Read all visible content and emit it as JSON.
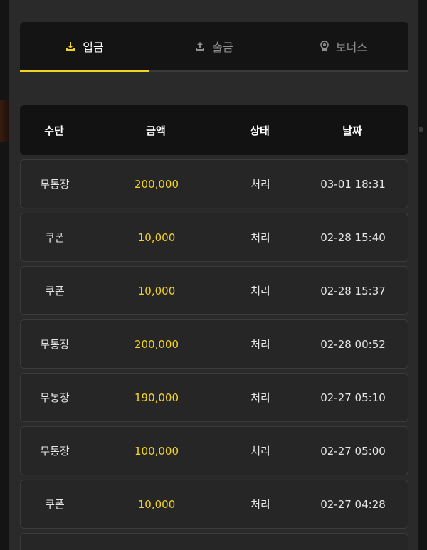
{
  "tabs": [
    {
      "label": "입금",
      "icon": "download-icon",
      "active": true
    },
    {
      "label": "출금",
      "icon": "upload-icon",
      "active": false
    },
    {
      "label": "보너스",
      "icon": "medal-icon",
      "active": false
    }
  ],
  "table": {
    "headers": [
      "수단",
      "금액",
      "상태",
      "날짜"
    ],
    "rows": [
      {
        "method": "무통장",
        "amount": "200,000",
        "status": "처리",
        "date": "03-01 18:31"
      },
      {
        "method": "쿠폰",
        "amount": "10,000",
        "status": "처리",
        "date": "02-28 15:40"
      },
      {
        "method": "쿠폰",
        "amount": "10,000",
        "status": "처리",
        "date": "02-28 15:37"
      },
      {
        "method": "무통장",
        "amount": "200,000",
        "status": "처리",
        "date": "02-28 00:52"
      },
      {
        "method": "무통장",
        "amount": "190,000",
        "status": "처리",
        "date": "02-27 05:10"
      },
      {
        "method": "무통장",
        "amount": "100,000",
        "status": "처리",
        "date": "02-27 05:00"
      },
      {
        "method": "쿠폰",
        "amount": "10,000",
        "status": "처리",
        "date": "02-27 04:28"
      }
    ]
  },
  "colors": {
    "accent": "#f0d21f",
    "background": "#2a2a2a",
    "header_bg": "#121212",
    "row_bg": "#262626"
  }
}
